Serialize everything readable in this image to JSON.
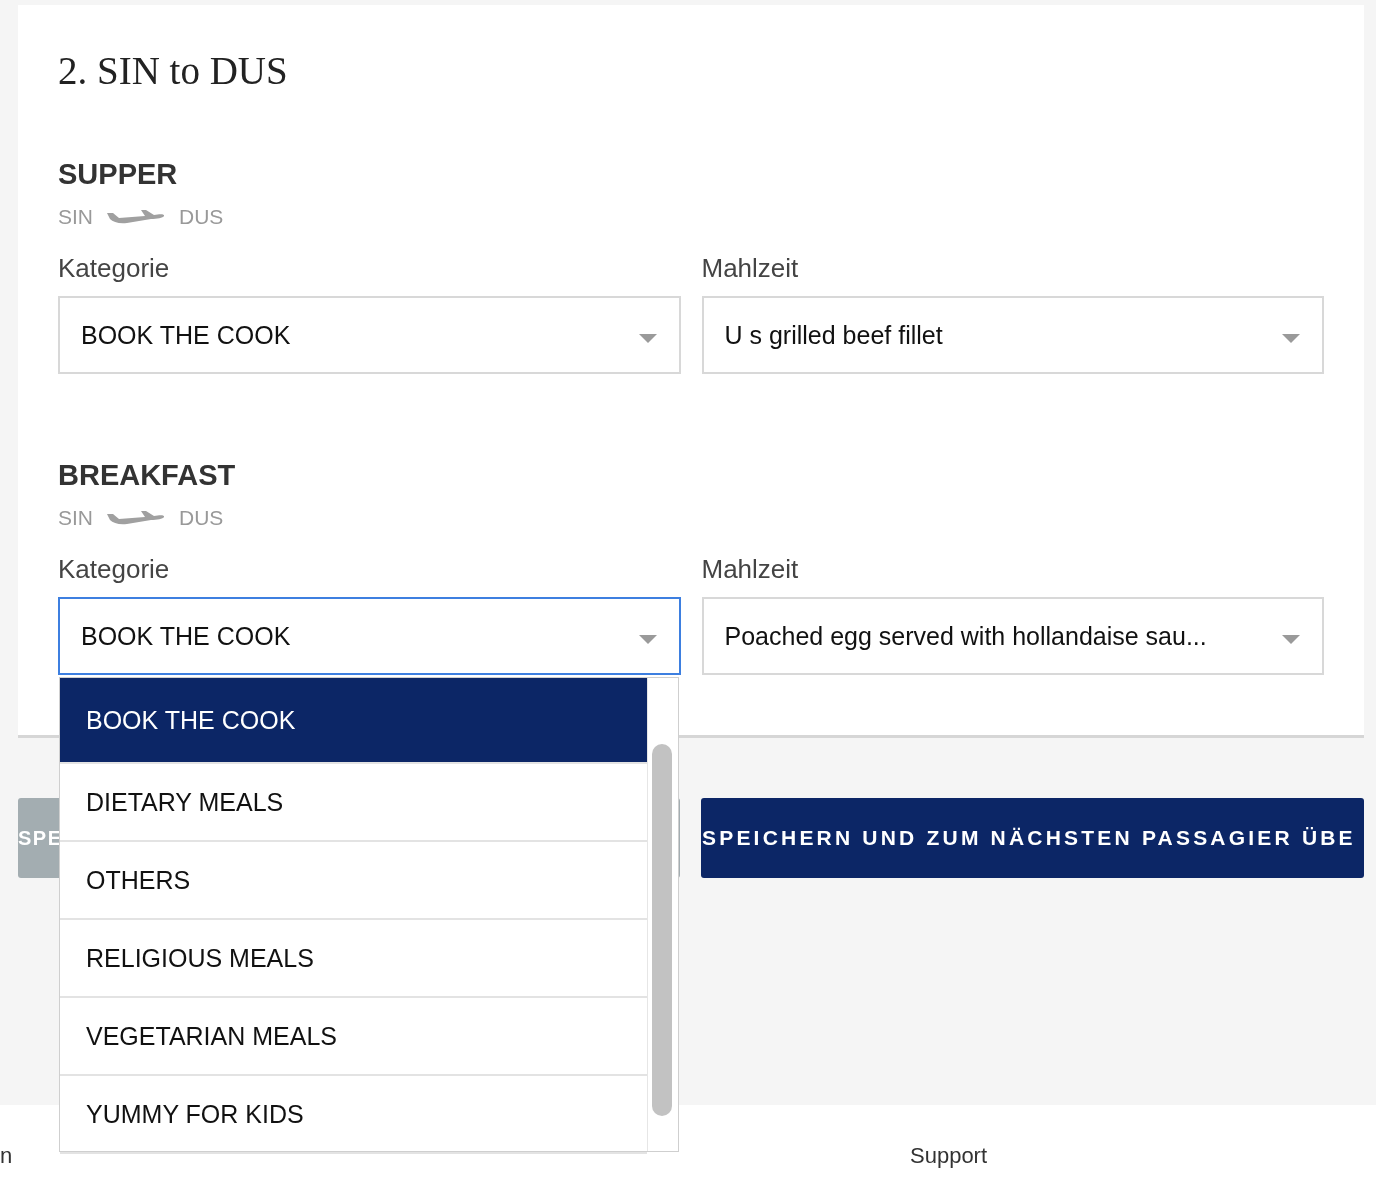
{
  "section_title": "2. SIN to DUS",
  "meals": [
    {
      "name": "SUPPER",
      "origin": "SIN",
      "destination": "DUS",
      "category": {
        "label": "Kategorie",
        "value": "BOOK THE COOK",
        "focused": false
      },
      "meal": {
        "label": "Mahlzeit",
        "value": "U s grilled beef fillet",
        "focused": false
      }
    },
    {
      "name": "BREAKFAST",
      "origin": "SIN",
      "destination": "DUS",
      "category": {
        "label": "Kategorie",
        "value": "BOOK THE COOK",
        "focused": true
      },
      "meal": {
        "label": "Mahlzeit",
        "value": "Poached egg served with hollandaise sau...",
        "focused": false
      }
    }
  ],
  "dropdown": {
    "options": [
      {
        "label": "BOOK THE COOK",
        "selected": true
      },
      {
        "label": "DIETARY MEALS",
        "selected": false
      },
      {
        "label": "OTHERS",
        "selected": false
      },
      {
        "label": "RELIGIOUS MEALS",
        "selected": false
      },
      {
        "label": "VEGETARIAN MEALS",
        "selected": false
      },
      {
        "label": "YUMMY FOR KIDS",
        "selected": false
      }
    ]
  },
  "buttons": [
    {
      "label": "SPE",
      "kind": "secondary"
    },
    {
      "label": "SPEICHERN UND ZUM NÄCHSTEN PASSAGIER ÜBE",
      "kind": "primary"
    }
  ],
  "footer": {
    "headings": [
      "n",
      "Support"
    ]
  }
}
